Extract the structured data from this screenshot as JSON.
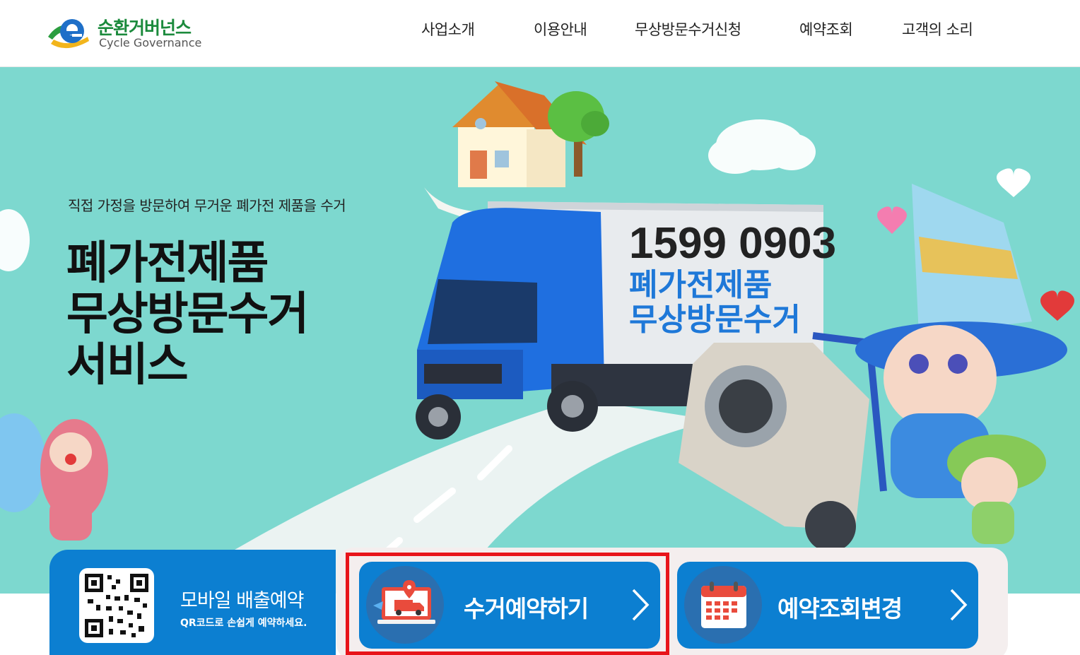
{
  "header": {
    "logo_ko": "순환거버넌스",
    "logo_en": "Cycle Governance",
    "nav": [
      {
        "label": "사업소개"
      },
      {
        "label": "이용안내"
      },
      {
        "label": "무상방문수거신청"
      },
      {
        "label": "예약조회"
      },
      {
        "label": "고객의 소리"
      }
    ]
  },
  "hero": {
    "subtitle": "직접 가정을 방문하여 무거운 폐가전 제품을 수거",
    "title_lines": [
      "폐가전제품",
      "무상방문수거",
      "서비스"
    ],
    "truck_phone": "1599 0903",
    "truck_line1": "폐가전제품",
    "truck_line2": "무상방문수거"
  },
  "quick": {
    "qr_title": "모바일 배출예약",
    "qr_caption": "QR코드로 손쉽게 예약하세요.",
    "reserve_label": "수거예약하기",
    "lookup_label": "예약조회변경"
  },
  "colors": {
    "brand_green": "#1b8a3c",
    "hero_bg": "#7dd8cf",
    "button_blue": "#0c7fd1",
    "highlight_red": "#e8141a"
  }
}
